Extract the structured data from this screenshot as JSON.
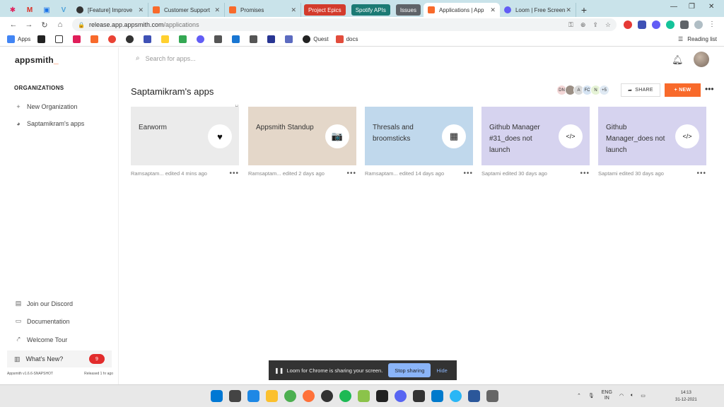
{
  "browser": {
    "tabs": [
      {
        "label": "[Feature] Improve ",
        "fav_color": "#333333"
      },
      {
        "label": "Customer Support",
        "fav_color": "#f86a2b"
      },
      {
        "label": "Promises",
        "fav_color": "#f86a2b"
      },
      {
        "label": "Applications | App",
        "fav_color": "#f86a2b",
        "active": true
      },
      {
        "label": "Loom | Free Screen",
        "fav_color": "#625df5"
      }
    ],
    "colored_tabs": [
      {
        "label": "Project Epics",
        "color": "#d33b2c"
      },
      {
        "label": "Spotify APIs",
        "color": "#1b7a74"
      },
      {
        "label": "Issues",
        "color": "#5f6368"
      }
    ],
    "url_host": "release.app.appsmith.com",
    "url_path": "/applications",
    "bookmarks": [
      {
        "label": "Apps",
        "color": "#4285f4"
      },
      {
        "label": "Quest",
        "color": "#222222"
      },
      {
        "label": "docs",
        "color": "#e24c3c"
      }
    ],
    "reading_list": "Reading list"
  },
  "app": {
    "logo_text": "appsmith",
    "logo_suffix": "_",
    "sidebar": {
      "heading": "ORGANIZATIONS",
      "new_org": "New Organization",
      "org_name": "Saptamikram's apps",
      "discord": "Join our Discord",
      "docs": "Documentation",
      "tour": "Welcome Tour",
      "whats_new": "What's New?",
      "whats_new_count": "9",
      "version": "Appsmith v1.6.6-SNAPSHOT",
      "released": "Released 1 hr ago"
    },
    "search_placeholder": "Search for apps...",
    "org_title": "Saptamikram's apps",
    "members": [
      {
        "initials": "DN",
        "color": "#f3d6d6"
      },
      {
        "initials": "",
        "color": "#9b8f85"
      },
      {
        "initials": "A",
        "color": "#d9d9d9"
      },
      {
        "initials": "FC",
        "color": "#d6e4f3"
      },
      {
        "initials": "N",
        "color": "#e6f3d6"
      },
      {
        "initials": "+5",
        "color": "#dfe9f3"
      }
    ],
    "share_label": "SHARE",
    "new_label": "+ NEW",
    "apps": [
      {
        "name": "Earworm",
        "bg": "#ebebeb",
        "icon": "♥",
        "edited": "Ramsaptam... edited 4 mins ago"
      },
      {
        "name": "Appsmith Standup",
        "bg": "#e4d7c9",
        "icon": "📷",
        "edited": "Ramsaptam... edited 2 days ago"
      },
      {
        "name": "Thresals and broomsticks",
        "bg": "#c0d8ec",
        "icon": "▦",
        "edited": "Ramsaptam... edited 14 days ago"
      },
      {
        "name": "Github Manager #31_does not launch",
        "bg": "#d6d3ef",
        "icon": "</>",
        "edited": "Saptami edited 30 days ago"
      },
      {
        "name": "Github Manager_does not launch",
        "bg": "#d6d3ef",
        "icon": "</>",
        "edited": "Saptami edited 30 days ago"
      }
    ]
  },
  "loom": {
    "message": "Loom for Chrome is sharing your screen.",
    "stop": "Stop sharing",
    "hide": "Hide"
  },
  "taskbar": {
    "lang_1": "ENG",
    "lang_2": "IN",
    "time": "14:13",
    "date": "31-12-2021"
  }
}
